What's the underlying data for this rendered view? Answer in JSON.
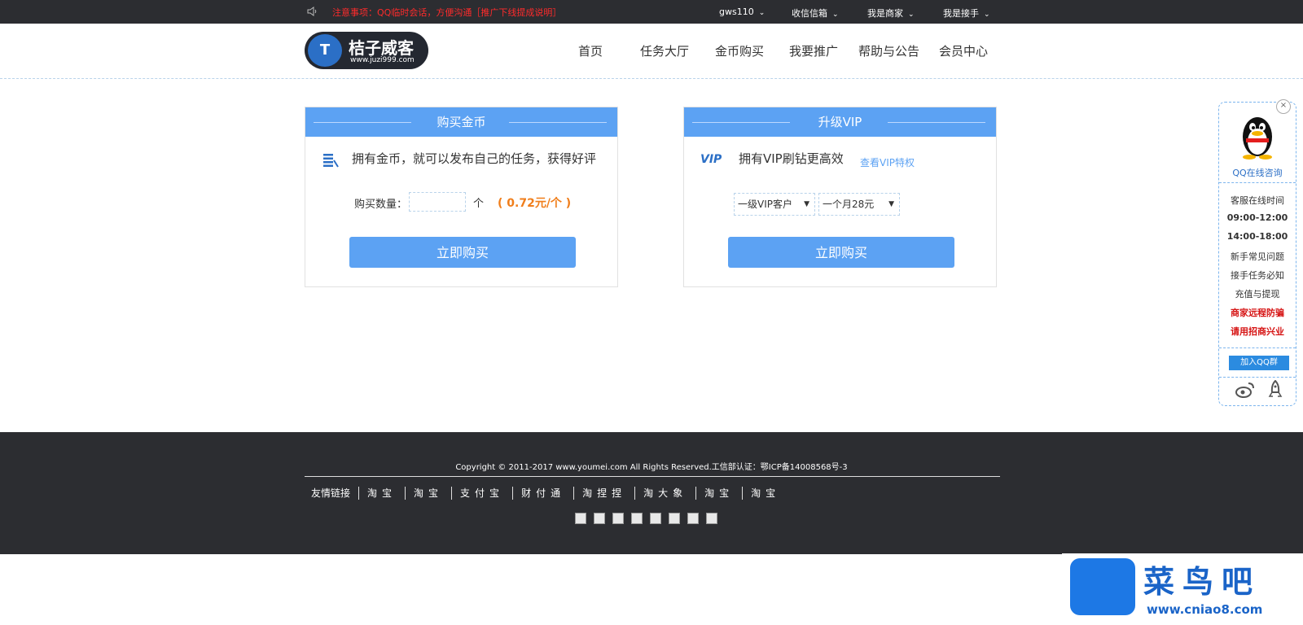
{
  "topbar": {
    "notice": "注意事项：QQ临时会话，方便沟通［推广下线提成说明］",
    "nav": [
      "gws110",
      "收信信箱",
      "我是商家",
      "我是接手"
    ]
  },
  "header": {
    "logo_name": "桔子威客",
    "logo_url": "www.juzi999.com",
    "logo_badge": "T",
    "nav": [
      "首页",
      "任务大厅",
      "金币购买",
      "我要推广",
      "帮助与公告",
      "会员中心"
    ]
  },
  "buy_coins": {
    "title": "购买金币",
    "desc": "拥有金币，就可以发布自己的任务，获得好评",
    "qty_label": "购买数量：",
    "qty_value": "",
    "unit": "个",
    "price": "( 0.72元/个 )",
    "button": "立即购买"
  },
  "vip": {
    "title": "升级VIP",
    "icon_text": "VIP",
    "desc": "拥有VIP刷钻更高效",
    "link": "查看VIP特权",
    "level_select": "一级VIP客户",
    "duration_select": "一个月28元",
    "button": "立即购买"
  },
  "side": {
    "close": "×",
    "title": "QQ在线咨询",
    "hours_label": "客服在线时间",
    "hours": [
      "09:00-12:00",
      "14:00-18:00"
    ],
    "links": [
      "新手常见问题",
      "接手任务必知",
      "充值与提现"
    ],
    "red_links": [
      "商家远程防骗",
      "请用招商兴业"
    ],
    "qq_group": "加入QQ群"
  },
  "footer": {
    "copyright": "Copyright © 2011-2017 www.youmei.com All Rights Reserved.工信部认证：鄂ICP备14008568号-3",
    "links_label": "友情链接",
    "links": [
      "淘宝",
      "淘宝",
      "支付宝",
      "财付通",
      "淘捏捏",
      "淘大象",
      "淘宝",
      "淘宝"
    ]
  },
  "watermark": {
    "name": "菜鸟吧",
    "url": "www.cniao8.com"
  },
  "colors": {
    "topbar_bg": "#2c2d31",
    "accent_blue": "#5ca2f3",
    "notice_red": "#ff2b2b",
    "price_orange": "#f07e1b"
  }
}
